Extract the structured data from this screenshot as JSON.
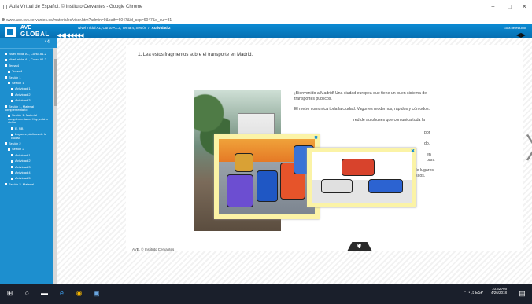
{
  "window": {
    "title": "Aula Virtual de Español. © Instituto Cervantes - Google Chrome",
    "url": "www.ave.cvc.cervantes.es/materiales/visor.htm?admin=0&path=6047&id_sep=6047&d_cur=81"
  },
  "header": {
    "logo_top": "AVE",
    "logo_bottom": "GLOBAL",
    "breadcrumb_prefix": "Nivel inicial A1, Curso A1.2, Tema 4, Sesión 7,",
    "breadcrumb_current": "Actividad 2",
    "util_label": "Guía de estudio"
  },
  "sidebar": {
    "collapse_label": "44",
    "items": [
      {
        "label": "Nivel inicial A1, Curso A1.2"
      },
      {
        "label": "Nivel inicial A1, Curso A1.2"
      },
      {
        "label": "Tema 4"
      },
      {
        "label": "Tema 4"
      },
      {
        "label": "Sesión 1"
      },
      {
        "label": "Sesión 1"
      },
      {
        "label": "Actividad 1"
      },
      {
        "label": "Actividad 2"
      },
      {
        "label": "Actividad 3"
      },
      {
        "label": "Sesión 1. Material complementario"
      },
      {
        "label": "Sesión 1. Material complementario. Hoy, está a ciclón"
      },
      {
        "label": "E. NB"
      },
      {
        "label": "Lugares públicos de la ciudad"
      },
      {
        "label": "Sesión 2"
      },
      {
        "label": "Sesión 2"
      },
      {
        "label": "Actividad 1"
      },
      {
        "label": "Actividad 2"
      },
      {
        "label": "Actividad 3"
      },
      {
        "label": "Actividad 4"
      },
      {
        "label": "Actividad 5"
      },
      {
        "label": "Sesión 2. Material"
      }
    ]
  },
  "content": {
    "question_num": "1.",
    "question": "Lea estos fragmentos sobre el transporte en Madrid.",
    "paragraphs": [
      "¡Bienvenido a Madrid! Una ciudad europea que tiene un buen sistema de transportes públicos.",
      "El metro comunica toda la ciudad. Vagones modernos, rápidos y cómodos.",
      "red de autobuses que comunica toda la",
      "por",
      "do,",
      "en para",
      "s de los problemas de esta ciudad son la falta de lugares para aparcar en el centro de la ciudad y los atascos."
    ],
    "credit": "AVE. © Instituto Cervantes"
  },
  "taskbar": {
    "time": "10:52 AM",
    "date": "4/26/2018",
    "lang": "ESP"
  },
  "colors": {
    "accent": "#0a8ad3",
    "sidebar": "#1d8fcf",
    "card": "#fbf3a6"
  }
}
